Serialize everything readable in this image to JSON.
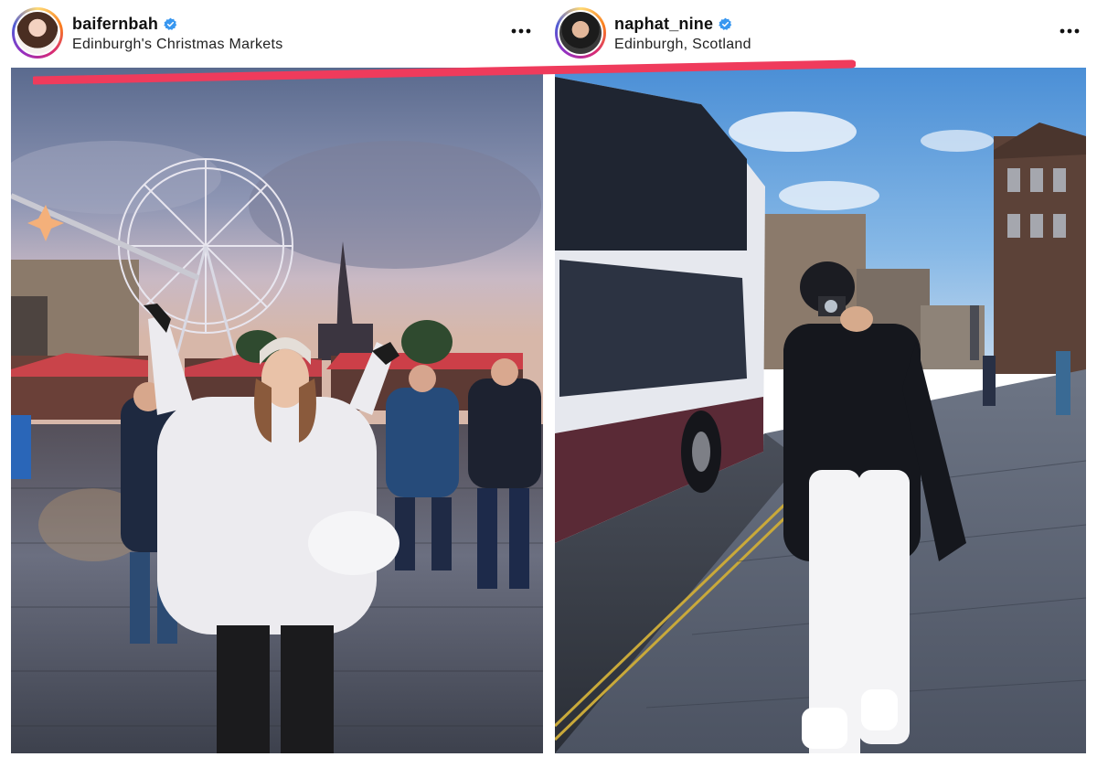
{
  "posts": [
    {
      "username": "baifernbah",
      "verified": true,
      "location": "Edinburgh's Christmas Markets",
      "avatar_icon": "profile-photo-woman",
      "more_icon": "more-options-icon"
    },
    {
      "username": "naphat_nine",
      "verified": true,
      "location": "Edinburgh, Scotland",
      "avatar_icon": "profile-photo-man",
      "more_icon": "more-options-icon"
    }
  ],
  "colors": {
    "verified_badge": "#3897f0",
    "highlight_line": "#ef3b5c",
    "story_ring": [
      "#feda75",
      "#fa7e1e",
      "#d62976",
      "#962fbf",
      "#4f5bd5"
    ]
  }
}
